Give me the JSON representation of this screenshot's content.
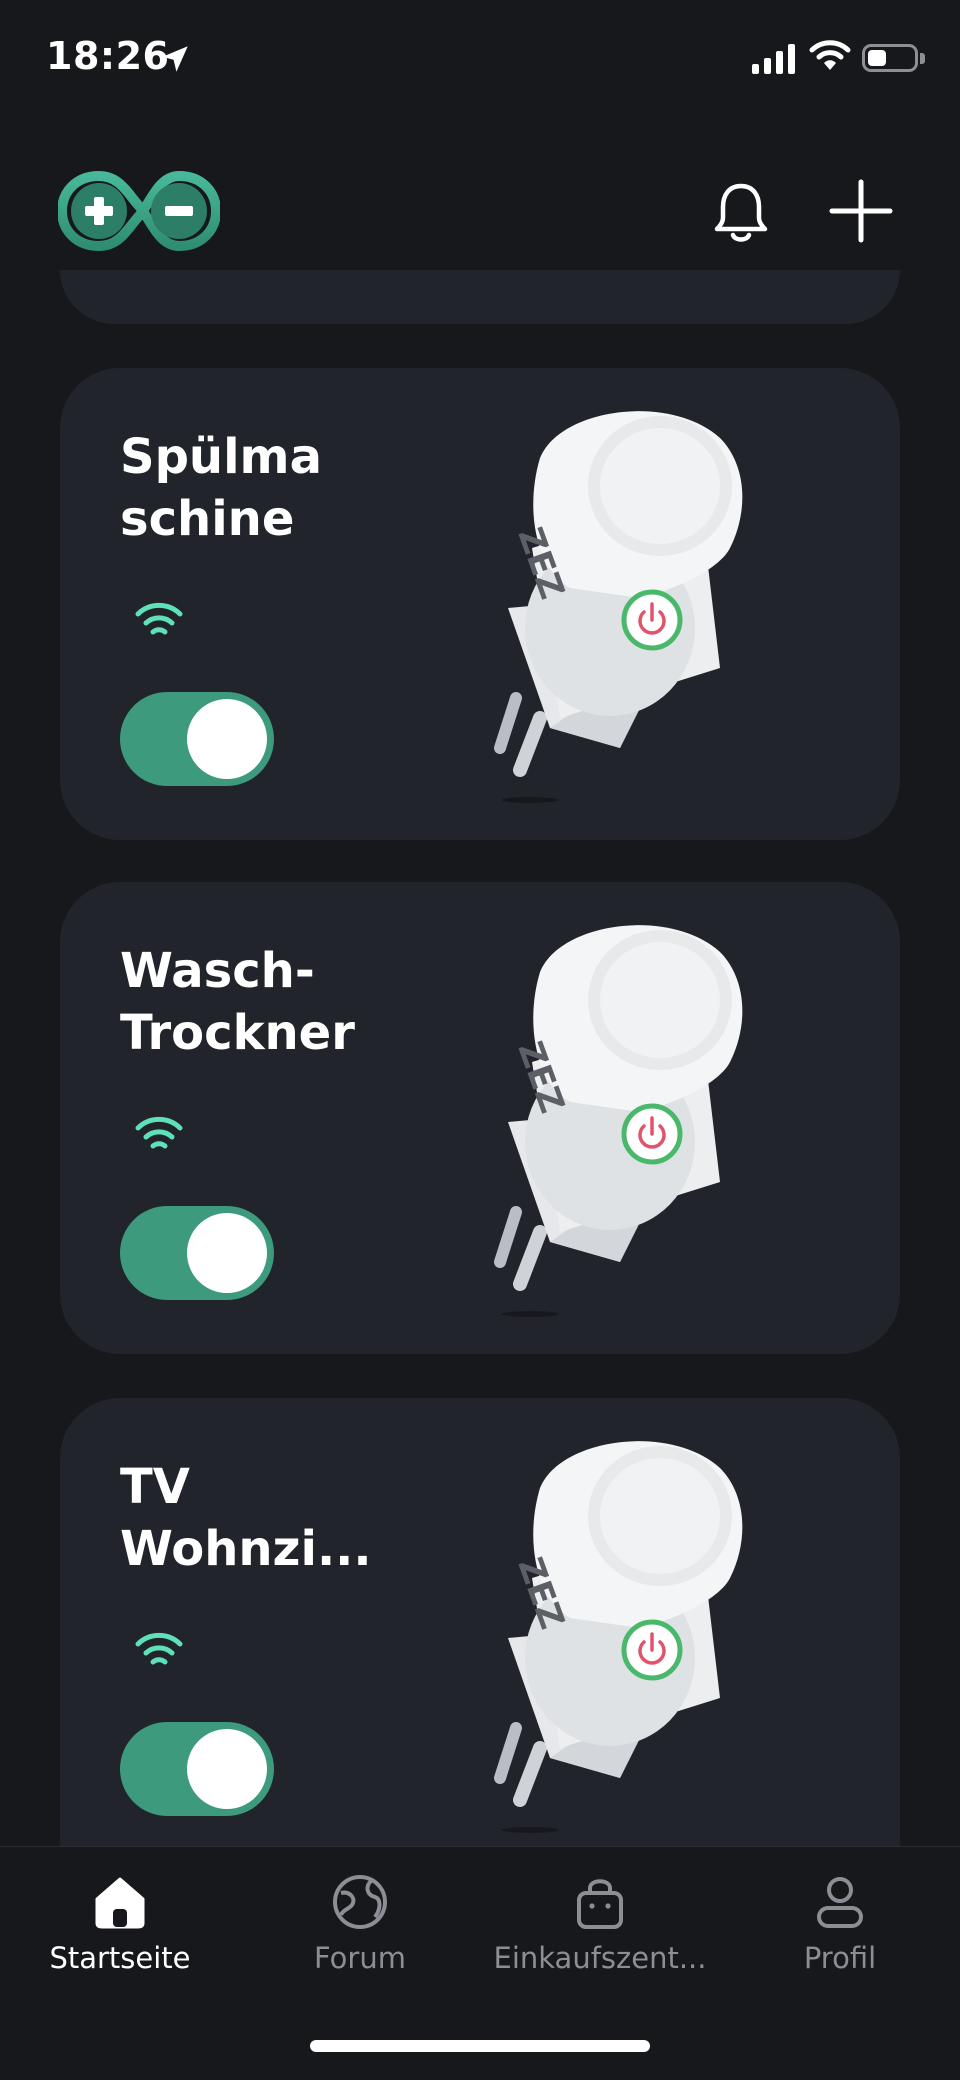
{
  "status_bar": {
    "time": "18:26",
    "battery_level": 0.35
  },
  "header": {
    "logo_icon": "arduino-infinity-logo",
    "notification_icon": "bell-icon",
    "add_icon": "plus-icon"
  },
  "devices": [
    {
      "name": "Spülma schine",
      "connected": true,
      "on": true
    },
    {
      "name": "Wasch-Trockner",
      "connected": true,
      "on": true
    },
    {
      "name": "TV Wohnzi...",
      "connected": true,
      "on": true
    }
  ],
  "tabbar": {
    "items": [
      {
        "label": "Startseite",
        "icon": "home-icon",
        "active": true
      },
      {
        "label": "Forum",
        "icon": "globe-icon",
        "active": false
      },
      {
        "label": "Einkaufszent...",
        "icon": "shopping-bag-icon",
        "active": false
      },
      {
        "label": "Profil",
        "icon": "profile-icon",
        "active": false
      }
    ]
  },
  "colors": {
    "background": "#16181c",
    "card": "#21242b",
    "accent": "#3d9a7d",
    "wifi": "#5ee0b8"
  }
}
